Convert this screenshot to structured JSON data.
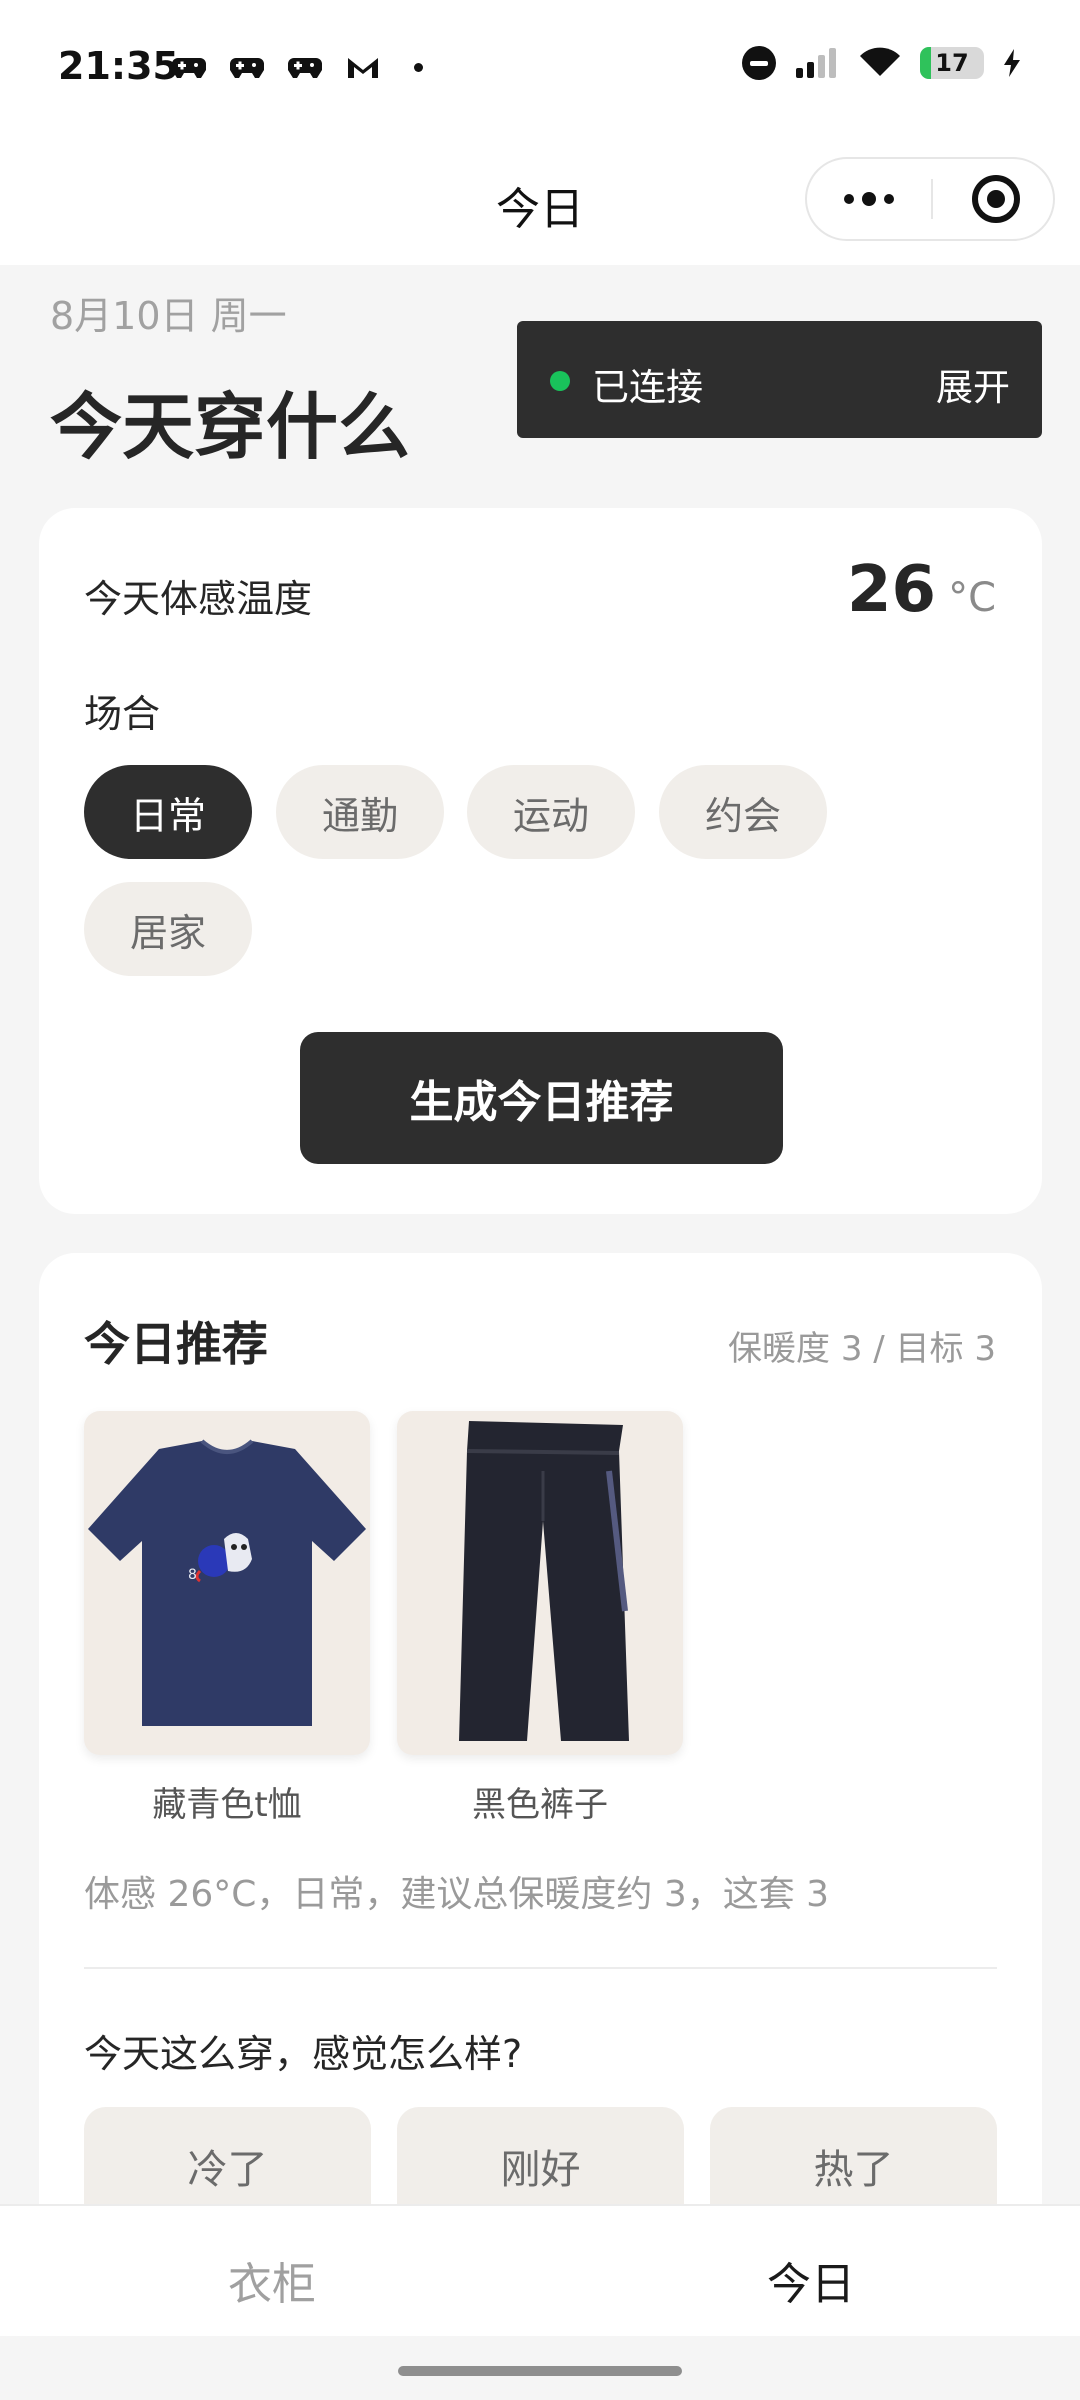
{
  "status_bar": {
    "time": "21:35",
    "left_icons": [
      "game-controller-icon",
      "game-controller-icon",
      "game-controller-icon",
      "gmail-icon",
      "dot-icon"
    ],
    "right_icons": [
      "do-not-disturb-icon",
      "signal-icon",
      "wifi-icon",
      "battery-icon",
      "charging-bolt-icon"
    ],
    "battery_level": "17",
    "battery_color": "#2fc25b"
  },
  "title_bar": {
    "title": "今日",
    "capsule_icons": [
      "more-icon",
      "close-target-icon"
    ]
  },
  "header": {
    "date": "8月10日 周一",
    "heading": "今天穿什么"
  },
  "connection": {
    "status_color": "#19c25b",
    "status": "已连接",
    "action": "展开"
  },
  "weather_card": {
    "temp_label": "今天体感温度",
    "temp_value": "26",
    "temp_unit": "°C",
    "occasion_label": "场合",
    "occasions": [
      {
        "label": "日常",
        "selected": true
      },
      {
        "label": "通勤",
        "selected": false
      },
      {
        "label": "运动",
        "selected": false
      },
      {
        "label": "约会",
        "selected": false
      },
      {
        "label": "居家",
        "selected": false
      }
    ],
    "generate_button": "生成今日推荐"
  },
  "recommendation": {
    "title": "今日推荐",
    "meta": "保暖度 3 / 目标 3",
    "items": [
      {
        "name": "藏青色t恤",
        "color": "#2f3a66",
        "icon": "navy-tshirt-image"
      },
      {
        "name": "黑色裤子",
        "color": "#232530",
        "icon": "black-pants-image"
      }
    ],
    "reason": "体感 26°C，日常，建议总保暖度约 3，这套 3",
    "question": "今天这么穿，感觉怎么样?",
    "feedback": [
      "冷了",
      "刚好",
      "热了"
    ]
  },
  "tab_bar": {
    "tabs": [
      {
        "label": "衣柜",
        "active": false
      },
      {
        "label": "今日",
        "active": true
      }
    ]
  },
  "colors": {
    "accent_dark": "#2e2e2e",
    "chip_bg": "#f1eeea",
    "page_bg": "#f5f5f5"
  }
}
